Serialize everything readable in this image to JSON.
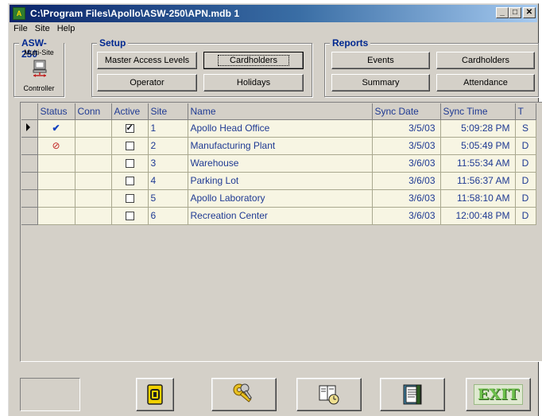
{
  "window": {
    "title": "C:\\Program Files\\Apollo\\ASW-250\\APN.mdb  1",
    "icon_text": "A",
    "minimize": "_",
    "maximize": "□",
    "close": "✕"
  },
  "menu": [
    {
      "label": "File"
    },
    {
      "label": "Site"
    },
    {
      "label": "Help"
    }
  ],
  "asw": {
    "label": "ASW-250",
    "sub": "Multi-Site",
    "footer": "Controller"
  },
  "setup": {
    "label": "Setup",
    "buttons": {
      "master_access_levels": "Master Access Levels",
      "cardholders": "Cardholders",
      "operator": "Operator",
      "holidays": "Holidays"
    }
  },
  "reports": {
    "label": "Reports",
    "buttons": {
      "events": "Events",
      "cardholders": "Cardholders",
      "summary": "Summary",
      "attendance": "Attendance"
    }
  },
  "grid": {
    "headers": {
      "status": "Status",
      "conn": "Conn",
      "active": "Active",
      "site": "Site",
      "name": "Name",
      "sync_date": "Sync Date",
      "sync_time": "Sync Time",
      "t": "T"
    },
    "rows": [
      {
        "status": "✔",
        "active": true,
        "site": "1",
        "name": "Apollo Head Office",
        "sync_date": "3/5/03",
        "sync_time": "5:09:28 PM",
        "t": "S"
      },
      {
        "status": "⊘",
        "active": false,
        "site": "2",
        "name": "Manufacturing Plant",
        "sync_date": "3/5/03",
        "sync_time": "5:05:49 PM",
        "t": "D"
      },
      {
        "status": "",
        "active": false,
        "site": "3",
        "name": "Warehouse",
        "sync_date": "3/6/03",
        "sync_time": "11:55:34 AM",
        "t": "D"
      },
      {
        "status": "",
        "active": false,
        "site": "4",
        "name": "Parking Lot",
        "sync_date": "3/6/03",
        "sync_time": "11:56:37 AM",
        "t": "D"
      },
      {
        "status": "",
        "active": false,
        "site": "5",
        "name": "Apollo Laboratory",
        "sync_date": "3/6/03",
        "sync_time": "11:58:10 AM",
        "t": "D"
      },
      {
        "status": "",
        "active": false,
        "site": "6",
        "name": "Recreation Center",
        "sync_date": "3/6/03",
        "sync_time": "12:00:48 PM",
        "t": "D"
      }
    ]
  },
  "toolbar": {
    "icons": [
      "blank",
      "card-icon",
      "keys-icon",
      "clock-book-icon",
      "report-book-icon",
      "exit-icon"
    ],
    "exit_label": "EXIT"
  }
}
